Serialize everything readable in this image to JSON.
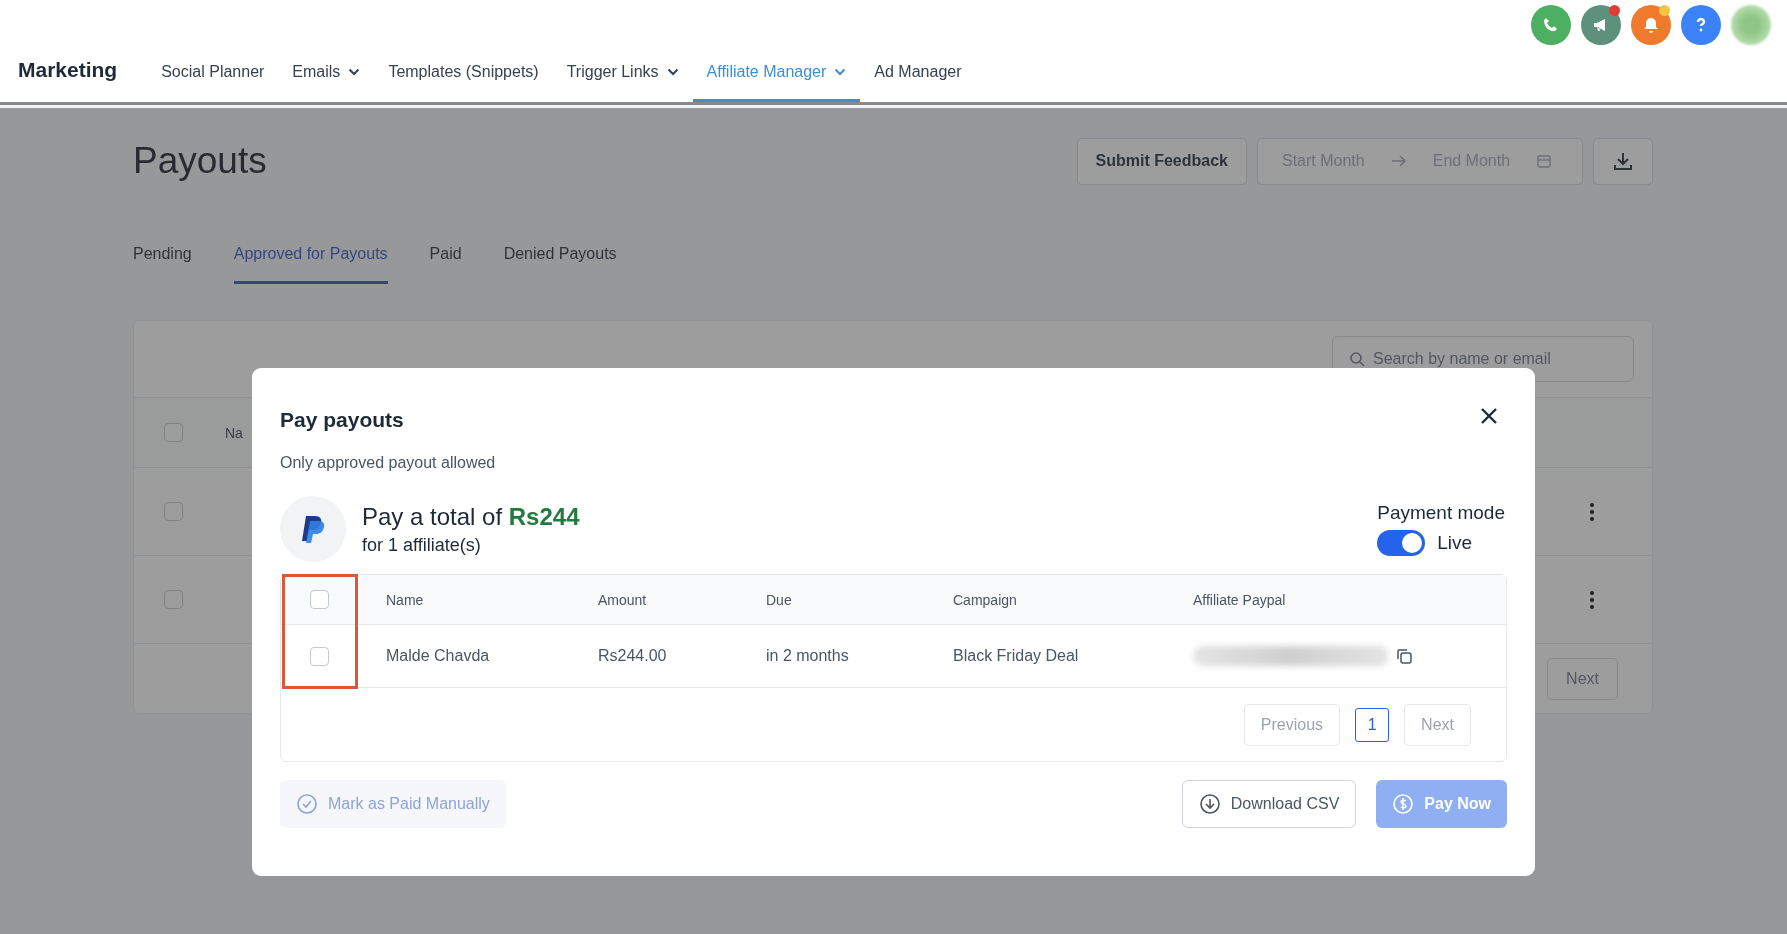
{
  "nav": {
    "brand": "Marketing",
    "items": [
      {
        "label": "Social Planner",
        "dropdown": false,
        "selected": false
      },
      {
        "label": "Emails",
        "dropdown": true,
        "selected": false
      },
      {
        "label": "Templates (Snippets)",
        "dropdown": false,
        "selected": false
      },
      {
        "label": "Trigger Links",
        "dropdown": true,
        "selected": false
      },
      {
        "label": "Affiliate Manager",
        "dropdown": true,
        "selected": true
      },
      {
        "label": "Ad Manager",
        "dropdown": false,
        "selected": false
      }
    ],
    "notifications": [
      {
        "kind": "phone",
        "badge": false
      },
      {
        "kind": "megaphone",
        "badge": true
      },
      {
        "kind": "bell",
        "badge": true
      },
      {
        "kind": "help",
        "badge": false
      }
    ]
  },
  "page": {
    "title": "Payouts",
    "feedback_button": "Submit Feedback",
    "date_range": {
      "start_placeholder": "Start Month",
      "end_placeholder": "End Month"
    },
    "tabs": [
      {
        "label": "Pending",
        "selected": false
      },
      {
        "label": "Approved for Payouts",
        "selected": true
      },
      {
        "label": "Paid",
        "selected": false
      },
      {
        "label": "Denied Payouts",
        "selected": false
      }
    ],
    "table": {
      "search": {
        "placeholder": "Search by name or email"
      },
      "columns": [
        "Na"
      ],
      "header_checked": false,
      "rows": [
        {
          "checked": false
        },
        {
          "checked": false
        }
      ],
      "next_button": "Next"
    }
  },
  "modal": {
    "title": "Pay payouts",
    "subtitle": "Only approved payout allowed",
    "total_prefix": "Pay a total of",
    "total": "Rs244",
    "affiliates": "for 1 affiliate(s)",
    "payment_mode": {
      "label": "Payment mode",
      "on": true,
      "value": "Live"
    },
    "table": {
      "columns": [
        "Name",
        "Amount",
        "Due",
        "Campaign",
        "Affiliate Paypal"
      ],
      "header_checked": false,
      "rows": [
        {
          "checked": false,
          "cells": [
            "Malde Chavda",
            "Rs244.00",
            "in 2 months",
            "Black Friday Deal"
          ]
        }
      ],
      "pagination": {
        "previous": "Previous",
        "pages": [
          {
            "label": "1",
            "selected": true
          }
        ],
        "next": "Next"
      }
    },
    "buttons": [
      {
        "kind": "manual",
        "label": "Mark as Paid Manually",
        "disabled": true
      },
      {
        "kind": "csv",
        "label": "Download CSV",
        "disabled": false
      },
      {
        "kind": "pay",
        "label": "Pay Now",
        "disabled": true
      }
    ]
  }
}
